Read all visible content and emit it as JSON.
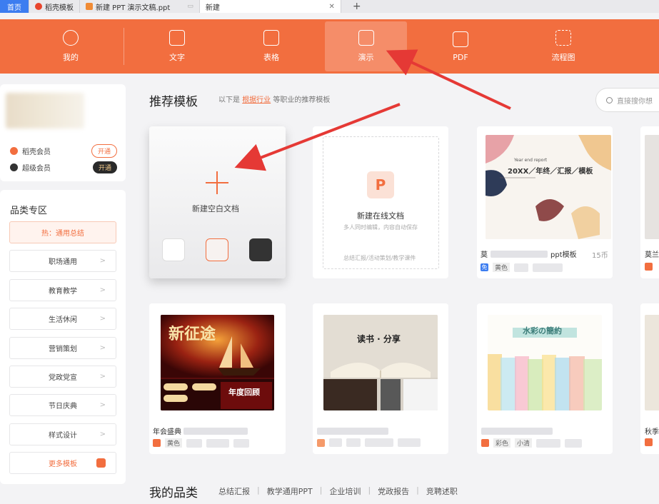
{
  "tabs": [
    {
      "label": "首页"
    },
    {
      "label": "稻壳模板"
    },
    {
      "label": "新建 PPT 演示文稿.ppt"
    },
    {
      "label": "新建"
    }
  ],
  "nav": {
    "items": [
      {
        "label": "我的"
      },
      {
        "label": "文字"
      },
      {
        "label": "表格"
      },
      {
        "label": "演示"
      },
      {
        "label": "PDF"
      },
      {
        "label": "流程图"
      }
    ]
  },
  "membership": [
    {
      "label": "稻壳会员",
      "action": "开通"
    },
    {
      "label": "超级会员",
      "action": "开通"
    }
  ],
  "categories": {
    "title": "品类专区",
    "items": [
      "热：通用总结",
      "职场通用",
      "教育教学",
      "生活休闲",
      "营销策划",
      "党政党宣",
      "节日庆典",
      "样式设计",
      "更多模板"
    ]
  },
  "recommend": {
    "title": "推荐模板",
    "sub_prefix": "以下是",
    "sub_link": "根据行业",
    "sub_suffix": "等职业的推荐模板",
    "search_placeholder": "直接搜你想"
  },
  "blank": {
    "label": "新建空白文档"
  },
  "online": {
    "title": "新建在线文档",
    "desc": "多人同时编辑，内容自动保存",
    "tags": "总结汇报/活动策划/教学课件"
  },
  "templates": {
    "t1_title_en": "Year end report",
    "t1_title": "20XX／年终／汇报／模板",
    "t1_caption_a": "莫",
    "t1_caption_b": "ppt模板",
    "t1_price": "15币",
    "t1_tag": "黄色",
    "t1_badge": "免",
    "t1_side": "莫兰",
    "t2_title": "新征途",
    "t2_sub": "年度回顾",
    "t2_caption": "年会盛典",
    "t2_tag": "黄色",
    "t3_title": "读书 · 分享",
    "t4_title": "水彩の簡約",
    "t4_tag": "彩色",
    "t4_tag2": "小清",
    "t4_side": "秋季"
  },
  "my_category": {
    "title": "我的品类",
    "links": [
      "总结汇报",
      "教学通用PPT",
      "企业培训",
      "党政报告",
      "竞聘述职"
    ]
  },
  "colors": {
    "accent": "#f26e3f",
    "home_tab": "#3c7df0"
  }
}
